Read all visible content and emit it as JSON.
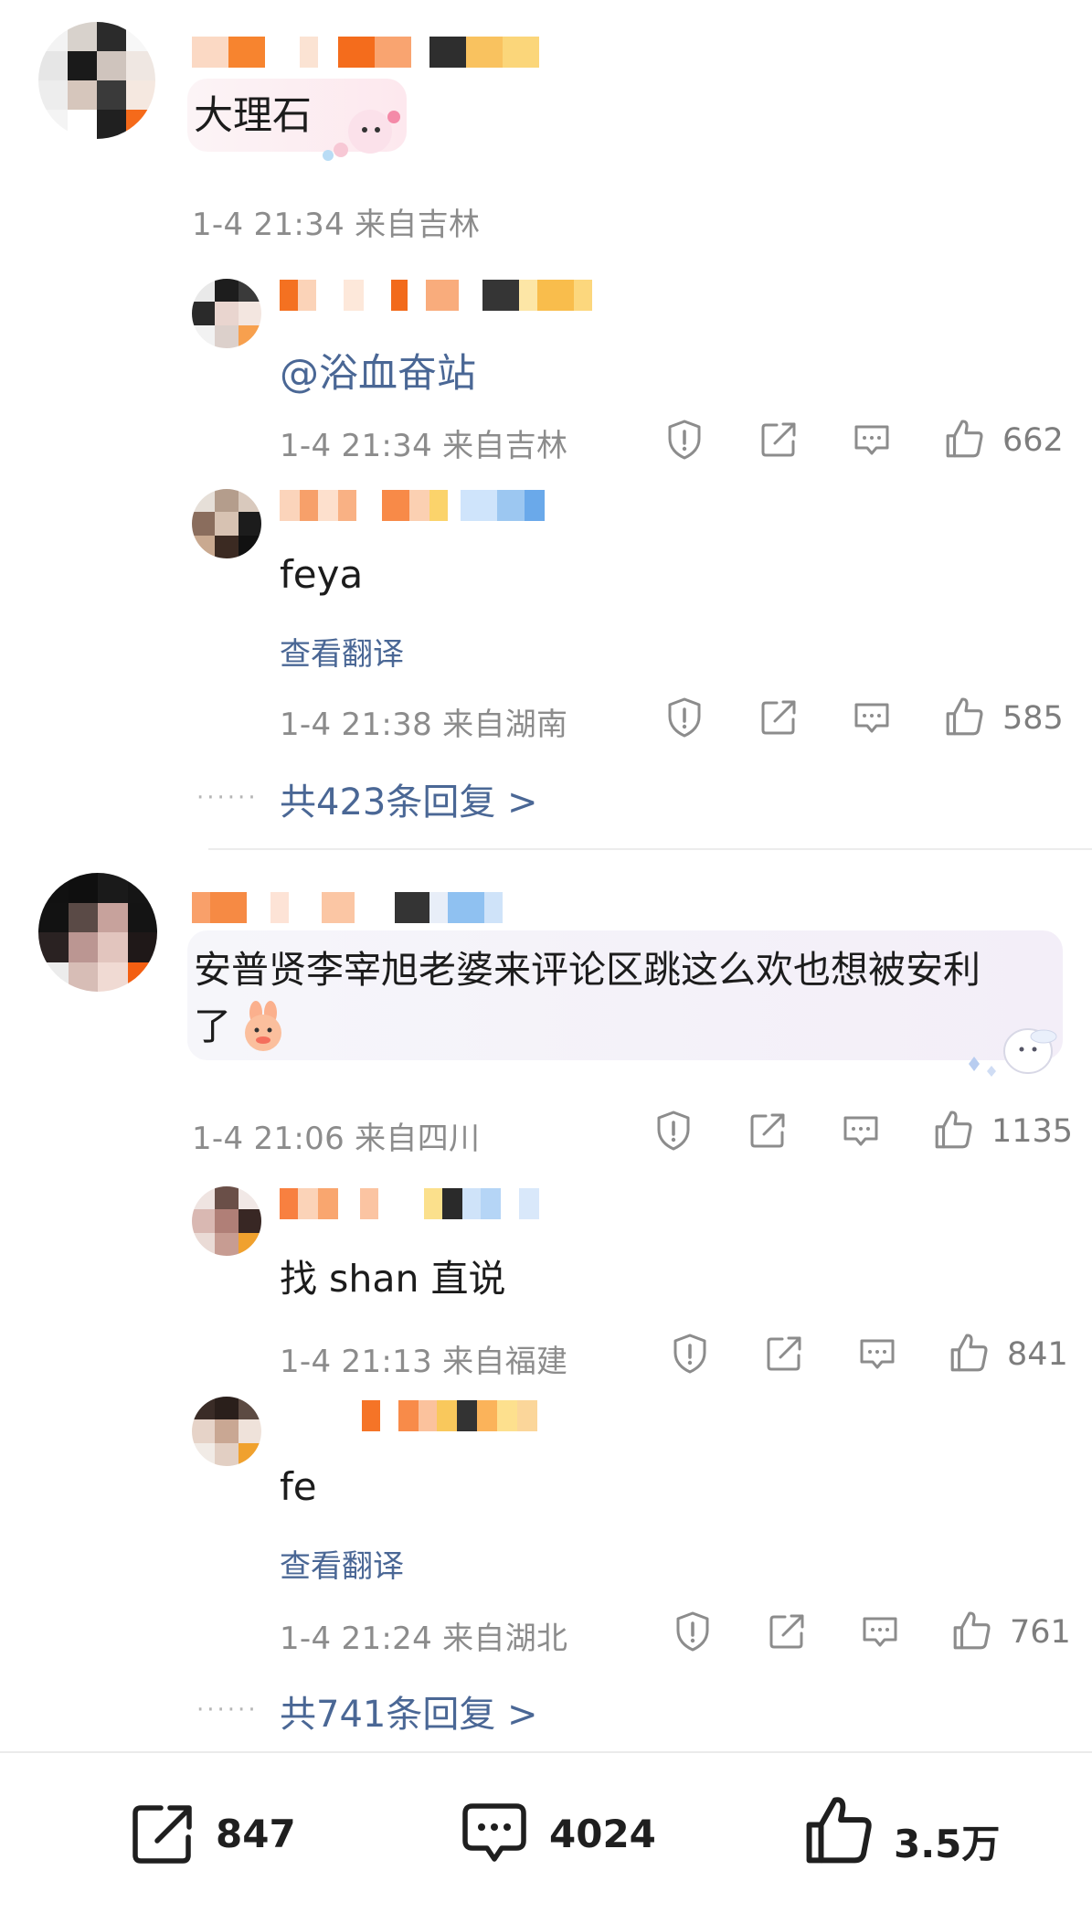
{
  "comments": [
    {
      "text": "大理石",
      "meta": "1-4 21:34  来自吉林",
      "replies": [
        {
          "mention": "@浴血奋站",
          "meta": "1-4 21:34  来自吉林",
          "likes": "662"
        },
        {
          "text": "feya",
          "translate": "查看翻译",
          "meta": "1-4 21:38  来自湖南",
          "likes": "585"
        }
      ],
      "more_replies": "共423条回复 >"
    },
    {
      "text_line1": "安普贤李宰旭老婆来评论区跳这么欢也想被安利",
      "text_line2": "了",
      "meta": "1-4 21:06  来自四川",
      "likes": "1135",
      "replies": [
        {
          "text": "找 shan 直说",
          "meta": "1-4 21:13  来自福建",
          "likes": "841"
        },
        {
          "text": "fe",
          "translate": "查看翻译",
          "meta": "1-4 21:24  来自湖北",
          "likes": "761"
        }
      ],
      "more_replies": "共741条回复 >"
    }
  ],
  "dots": "······",
  "icons": [
    "report-icon",
    "share-icon",
    "comment-icon",
    "like-icon"
  ],
  "bottom_bar": {
    "repost_count": "847",
    "comment_count": "4024",
    "like_count": "3.5万"
  },
  "colors": {
    "link": "#4a6795",
    "meta": "#8c8c8c",
    "accent_orange": "#f26a1b"
  }
}
